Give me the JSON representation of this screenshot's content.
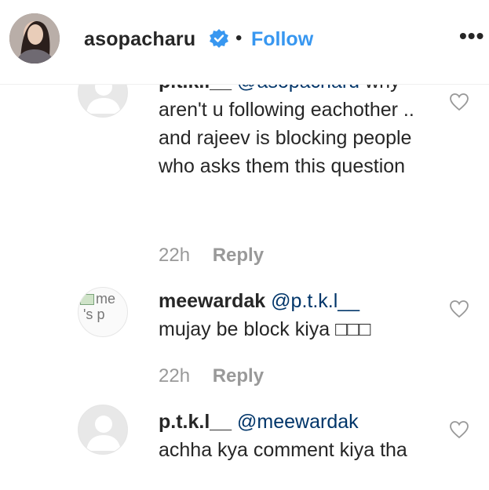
{
  "header": {
    "username": "asopacharu",
    "dot": "•",
    "follow_label": "Follow",
    "more_label": "•••",
    "verified_color": "#3897f0"
  },
  "comments": [
    {
      "author": "p.t.k.l__",
      "mention": "@asopacharu",
      "text": "why aren't u following eachother .. and rajeev is blocking people who asks them this question",
      "time": "22h",
      "reply_label": "Reply"
    },
    {
      "author": "meewardak",
      "mention": "@p.t.k.l__",
      "text": "mujay be block kiya □□□",
      "time": "22h",
      "reply_label": "Reply",
      "avatar_alt_1": "me",
      "avatar_alt_2": "'s p"
    },
    {
      "author": "p.t.k.l__",
      "mention": "@meewardak",
      "text": "achha kya comment kiya tha"
    }
  ]
}
